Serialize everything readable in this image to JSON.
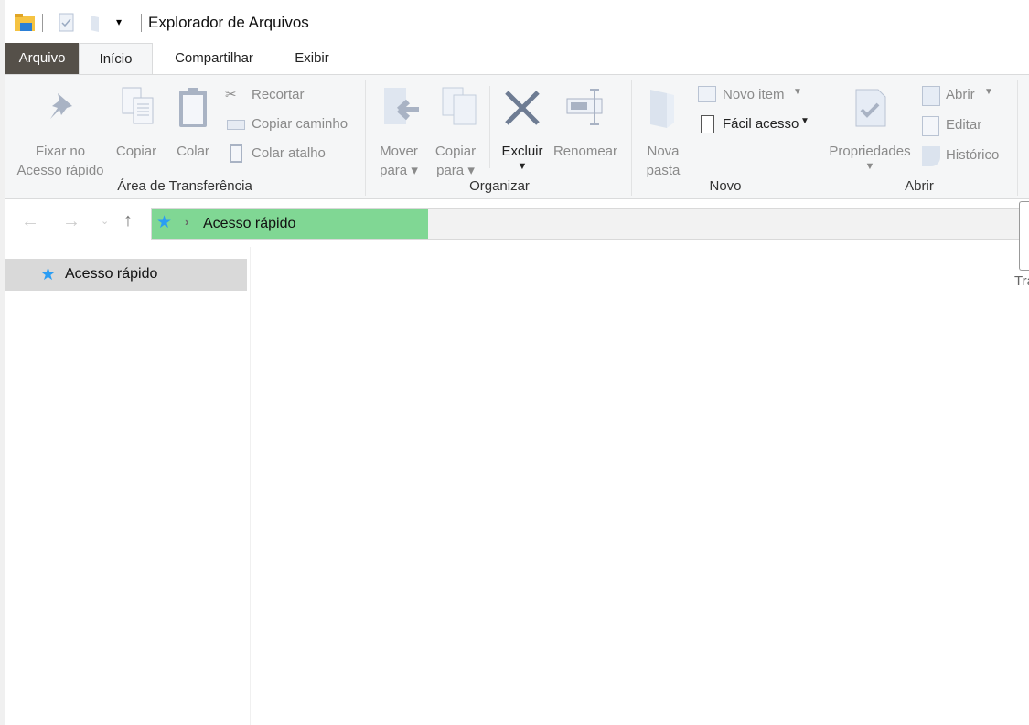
{
  "window": {
    "title": "Explorador de Arquivos"
  },
  "tabs": [
    {
      "label": "Arquivo"
    },
    {
      "label": "Início"
    },
    {
      "label": "Compartilhar"
    },
    {
      "label": "Exibir"
    }
  ],
  "ribbon": {
    "clipboard": {
      "group": "Área de Transferência",
      "pin": "Fixar no",
      "pin2": "Acesso rápido",
      "copy": "Copiar",
      "paste": "Colar",
      "cut": "Recortar",
      "copy_path": "Copiar caminho",
      "paste_shortcut": "Colar atalho"
    },
    "organize": {
      "group": "Organizar",
      "move": "Mover",
      "move2": "para",
      "copyto": "Copiar",
      "copyto2": "para",
      "delete": "Excluir",
      "rename": "Renomear"
    },
    "new": {
      "group": "Novo",
      "folder": "Nova",
      "folder2": "pasta",
      "new_item": "Novo item",
      "easy_access": "Fácil acesso"
    },
    "open": {
      "group": "Abrir",
      "properties": "Propriedades",
      "open": "Abrir",
      "edit": "Editar",
      "history": "Histórico"
    }
  },
  "address": {
    "path": "Acesso rápido",
    "accent": "#80d794"
  },
  "nav": {
    "items": [
      {
        "label": "Acesso rápido",
        "selected": true
      }
    ]
  },
  "right_edge_text": "Tra"
}
